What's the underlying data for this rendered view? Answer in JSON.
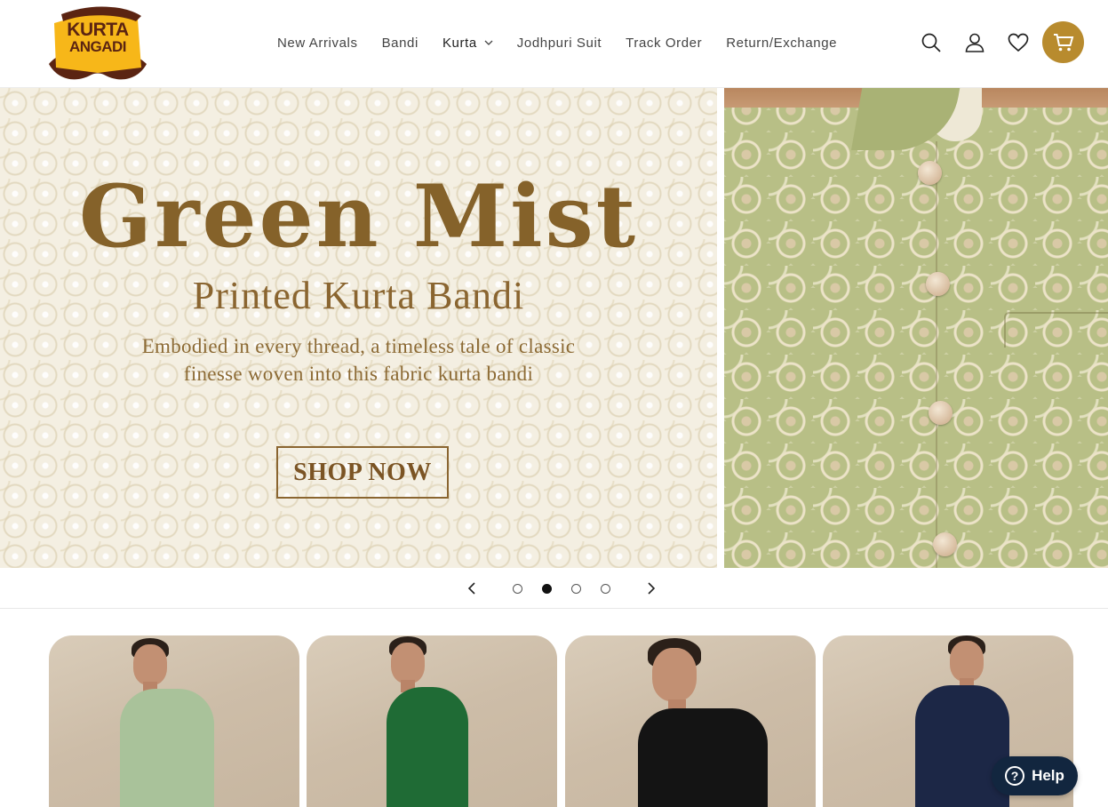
{
  "brand": {
    "logo_line1": "KURTA",
    "logo_line2": "ANGADI",
    "colors": {
      "accent": "#b88b2e",
      "logo_yellow": "#f7b719",
      "logo_brown": "#5b2412"
    }
  },
  "nav": {
    "items": [
      {
        "label": "New Arrivals",
        "icon": ""
      },
      {
        "label": "Bandi",
        "icon": ""
      },
      {
        "label": "Kurta",
        "icon": "chevron-down-icon"
      },
      {
        "label": "Jodhpuri Suit",
        "icon": ""
      },
      {
        "label": "Track Order",
        "icon": ""
      },
      {
        "label": "Return/Exchange",
        "icon": ""
      }
    ]
  },
  "header_icons": [
    "search-icon",
    "user-icon",
    "heart-icon",
    "cart-icon"
  ],
  "hero": {
    "headline": "Green Mist",
    "subheadline": "Printed Kurta Bandi",
    "description_line1": "Embodied in every thread, a timeless tale of classic",
    "description_line2": "finesse woven into this fabric kurta bandi",
    "cta_label": "SHOP NOW",
    "text_color": "#85622a"
  },
  "slider": {
    "slide_count": 4,
    "active_index": 1,
    "prev_icon": "chevron-left-icon",
    "next_icon": "chevron-right-icon"
  },
  "products": [
    {
      "name": "light-green-kurta",
      "color": "#a9c29a"
    },
    {
      "name": "green-kurta",
      "color": "#1f6b35"
    },
    {
      "name": "black-kurta",
      "color": "#141414"
    },
    {
      "name": "navy-kurta",
      "color": "#1c2746"
    }
  ],
  "help": {
    "label": "Help",
    "icon": "question-icon",
    "bg": "#12263f"
  }
}
